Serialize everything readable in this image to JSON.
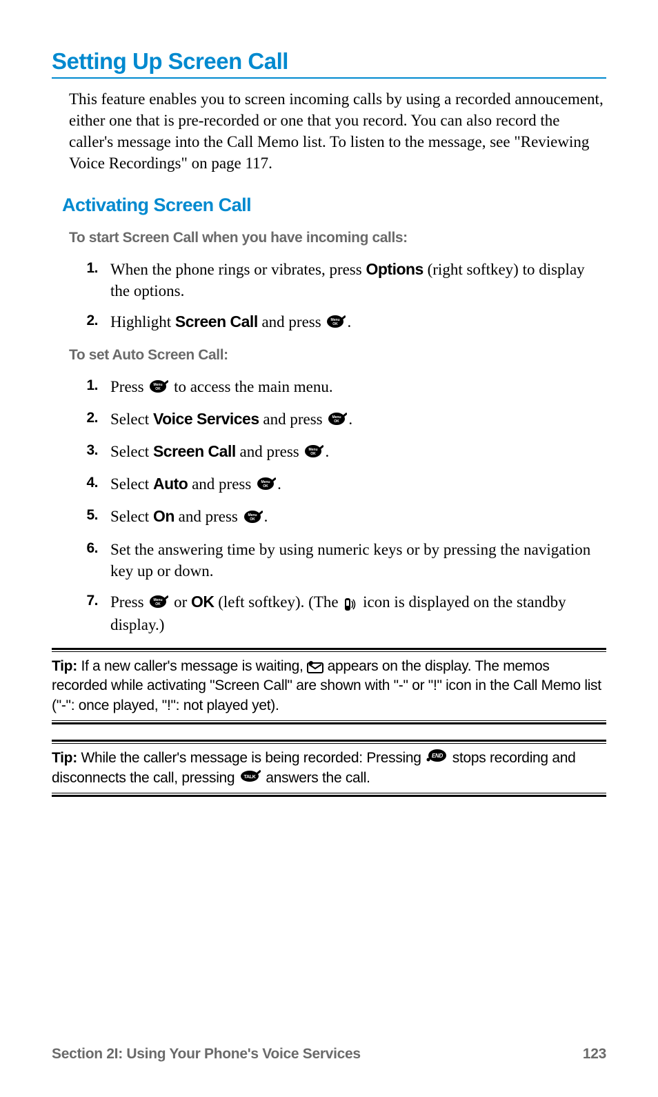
{
  "title": "Setting Up Screen Call",
  "intro": "This feature enables you to screen incoming calls by using a recorded annoucement, either one that is pre-recorded or one that you record. You can also record the caller's message into the Call Memo list. To listen to the message, see \"Reviewing Voice Recordings\" on page 117.",
  "subtitle": "Activating Screen Call",
  "heading1": "To start Screen Call when you have incoming calls:",
  "list1": {
    "s1": {
      "num": "1.",
      "pre": "When the phone rings or vibrates, press ",
      "bold": "Options",
      "post": " (right softkey) to display the options."
    },
    "s2": {
      "num": "2.",
      "pre": "Highlight ",
      "bold": "Screen Call",
      "mid": " and press ",
      "post": "."
    }
  },
  "heading2": "To set Auto Screen Call:",
  "list2": {
    "s1": {
      "num": "1.",
      "pre": "Press ",
      "post": " to access the main menu."
    },
    "s2": {
      "num": "2.",
      "pre": "Select ",
      "bold": "Voice Services",
      "mid": " and press ",
      "post": "."
    },
    "s3": {
      "num": "3.",
      "pre": "Select ",
      "bold": "Screen Call",
      "mid": " and press ",
      "post": "."
    },
    "s4": {
      "num": "4.",
      "pre": "Select ",
      "bold": "Auto",
      "mid": " and press ",
      "post": "."
    },
    "s5": {
      "num": "5.",
      "pre": "Select ",
      "bold": "On",
      "mid": " and press ",
      "post": "."
    },
    "s6": {
      "num": "6.",
      "text": "Set the answering time by using numeric keys or by pressing the navigation key up or down."
    },
    "s7": {
      "num": "7.",
      "pre": "Press ",
      "mid1": " or ",
      "bold": "OK",
      "mid2": " (left softkey). (The ",
      "post": " icon is displayed on the standby display.)"
    }
  },
  "tip1": {
    "label": "Tip:",
    "pre": " If a new caller's message is waiting, ",
    "post": " appears on the display. The memos recorded while activating \"Screen Call\" are shown with \"-\" or \"!\" icon in the Call Memo list (\"-\": once played, \"!\": not played yet)."
  },
  "tip2": {
    "label": "Tip:",
    "pre": " While the caller's message is being recorded: Pressing ",
    "mid": " stops recording and disconnects the call, pressing ",
    "post": " answers the call."
  },
  "footer": {
    "section": "Section 2I: Using Your Phone's Voice Services",
    "page": "123"
  }
}
